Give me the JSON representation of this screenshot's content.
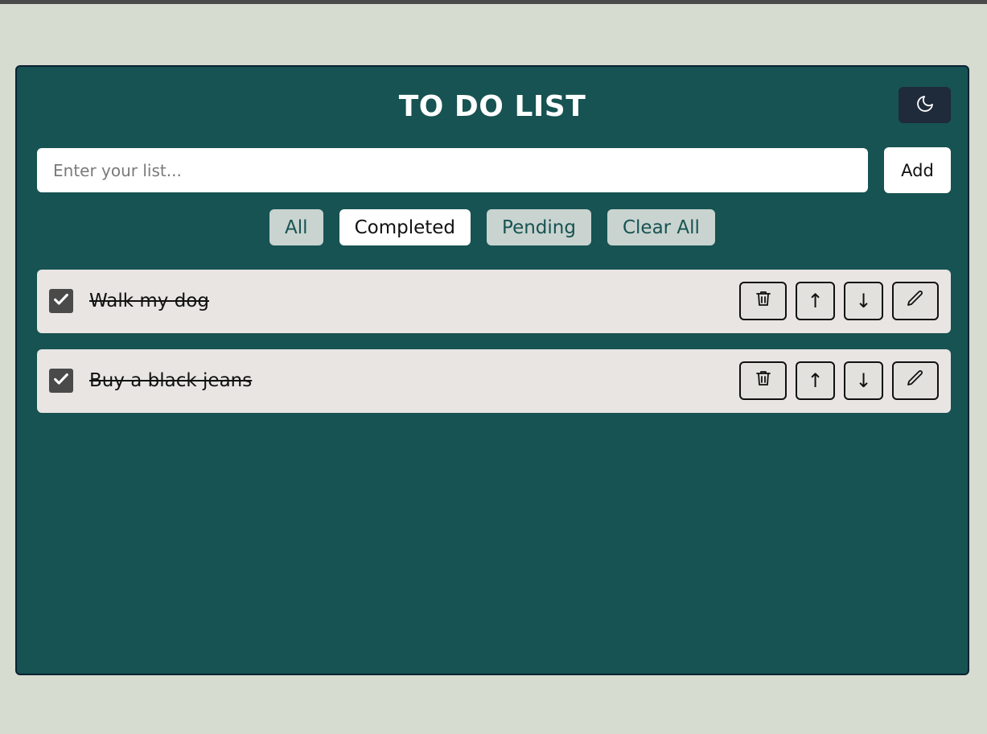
{
  "header": {
    "title": "TO DO LIST",
    "theme_toggle_icon": "moon-icon"
  },
  "input": {
    "placeholder": "Enter your list...",
    "value": "",
    "add_label": "Add"
  },
  "filters": [
    {
      "label": "All",
      "active": false
    },
    {
      "label": "Completed",
      "active": true
    },
    {
      "label": "Pending",
      "active": false
    },
    {
      "label": "Clear All",
      "active": false
    }
  ],
  "todos": [
    {
      "text": "Walk my dog",
      "completed": true
    },
    {
      "text": "Buy a black jeans",
      "completed": true
    }
  ],
  "item_actions": {
    "delete_icon": "trash-icon",
    "up_label": "↑",
    "down_label": "↓",
    "edit_icon": "pencil-icon"
  },
  "colors": {
    "page_bg": "#d6dccf",
    "card_bg": "#165352",
    "theme_button_bg": "#1f2a3a",
    "filter_bg": "#c9d3cf",
    "filter_text": "#165352",
    "item_bg": "#e8e5e3"
  }
}
